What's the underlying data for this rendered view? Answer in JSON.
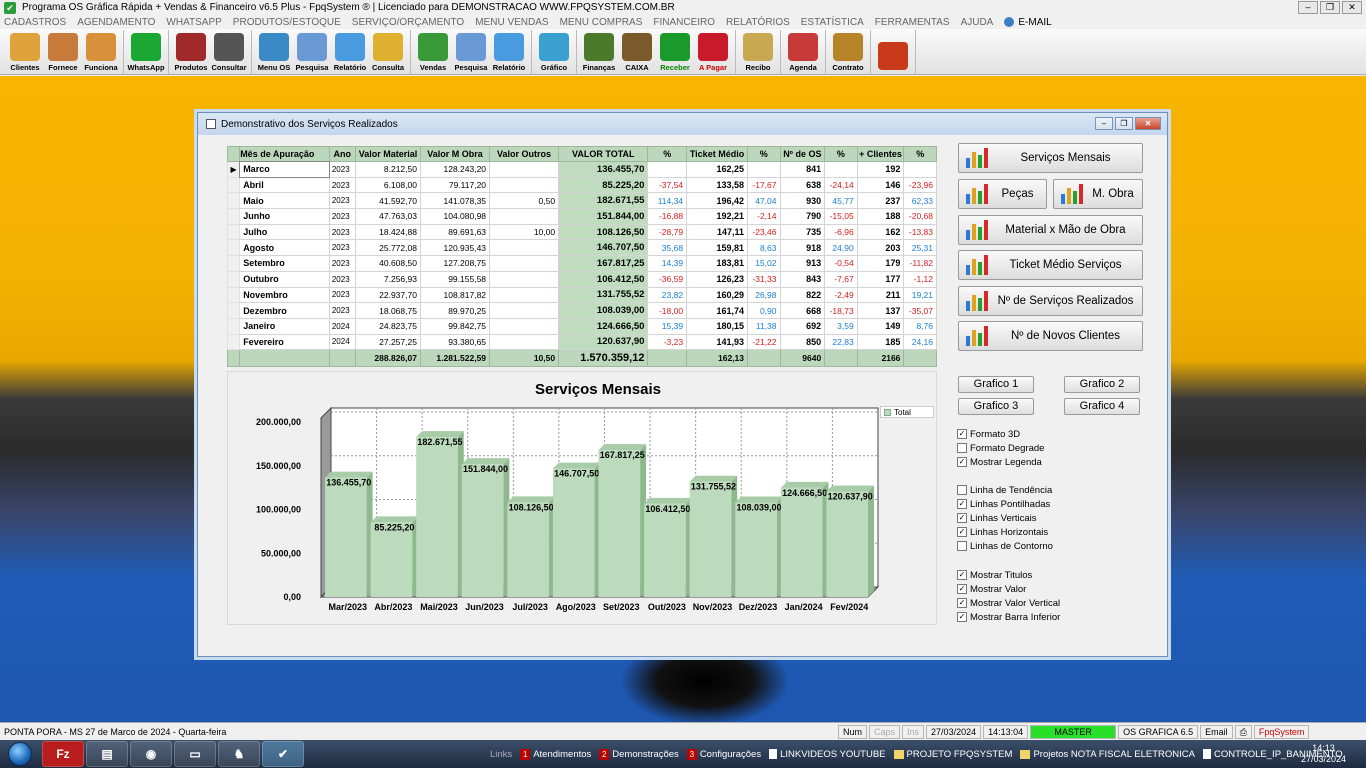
{
  "app": {
    "title": "Programa OS Gráfica Rápida + Vendas & Financeiro v6.5 Plus - FpqSystem ® | Licenciado para  DEMONSTRACAO WWW.FPQSYSTEM.COM.BR"
  },
  "menu": [
    "CADASTROS",
    "AGENDAMENTO",
    "WHATSAPP",
    "PRODUTOS/ESTOQUE",
    "SERVIÇO/ORÇAMENTO",
    "MENU VENDAS",
    "MENU COMPRAS",
    "FINANCEIRO",
    "RELATÓRIOS",
    "ESTATÍSTICA",
    "FERRAMENTAS",
    "AJUDA"
  ],
  "menu_email": "E-MAIL",
  "toolbar": [
    [
      {
        "label": "Clientes",
        "icon": "clients-icon",
        "color": "#e0a23a"
      },
      {
        "label": "Fornece",
        "icon": "supplier-icon",
        "color": "#c77a3a"
      },
      {
        "label": "Funciona",
        "icon": "employee-icon",
        "color": "#d8913a"
      }
    ],
    [
      {
        "label": "WhatsApp",
        "icon": "whatsapp-icon",
        "color": "#1aa832"
      }
    ],
    [
      {
        "label": "Produtos",
        "icon": "products-icon",
        "color": "#a02a2a"
      },
      {
        "label": "Consultar",
        "icon": "barcode-icon",
        "color": "#555555"
      }
    ],
    [
      {
        "label": "Menu OS",
        "icon": "service-order-icon",
        "color": "#3a8ac6"
      },
      {
        "label": "Pesquisa",
        "icon": "search-doc-icon",
        "color": "#6a9ad6"
      },
      {
        "label": "Relatório",
        "icon": "report-icon",
        "color": "#4a9ae0"
      },
      {
        "label": "Consulta",
        "icon": "folder-icon",
        "color": "#e0b030"
      }
    ],
    [
      {
        "label": "Vendas",
        "icon": "cart-icon",
        "color": "#3a9a3a"
      },
      {
        "label": "Pesquisa",
        "icon": "search-doc-icon",
        "color": "#6a9ad6"
      },
      {
        "label": "Relatório",
        "icon": "report-icon",
        "color": "#4a9ae0"
      }
    ],
    [
      {
        "label": "Gráfico",
        "icon": "chart-icon",
        "color": "#3aa0d0"
      }
    ],
    [
      {
        "label": "Finanças",
        "icon": "finance-icon",
        "color": "#4a7a2a"
      },
      {
        "label": "CAIXA",
        "icon": "cashier-icon",
        "color": "#7a5a2a"
      },
      {
        "label": "Receber",
        "icon": "receive-icon",
        "color": "#1a9a2a",
        "label_color": "green"
      },
      {
        "label": "A Pagar",
        "icon": "pay-icon",
        "color": "#c81a2a",
        "label_color": "red"
      }
    ],
    [
      {
        "label": "Recibo",
        "icon": "receipt-icon",
        "color": "#c8a850"
      }
    ],
    [
      {
        "label": "Agenda",
        "icon": "calendar-icon",
        "color": "#c83a3a"
      }
    ],
    [
      {
        "label": "Contrato",
        "icon": "contract-icon",
        "color": "#b8842a"
      }
    ],
    [
      {
        "label": "",
        "icon": "exit-icon",
        "color": "#c83a1a"
      }
    ]
  ],
  "dialog": {
    "title": "Demonstrativo dos Serviços Realizados"
  },
  "grid": {
    "headers": [
      "Mês de Apuração",
      "Ano",
      "Valor Material",
      "Valor M Obra",
      "Valor Outros",
      "VALOR TOTAL",
      "%",
      "Ticket Médio",
      "%",
      "Nº de OS",
      "%",
      "+ Clientes",
      "%"
    ],
    "rows": [
      {
        "mes": "Marco",
        "ano": "2023",
        "material": "8.212,50",
        "mobra": "128.243,20",
        "outros": "",
        "total": "136.455,70",
        "p1": "",
        "ticket": "162,25",
        "p2": "",
        "nos": "841",
        "p3": "",
        "clientes": "192",
        "p4": ""
      },
      {
        "mes": "Abril",
        "ano": "2023",
        "material": "6.108,00",
        "mobra": "79.117,20",
        "outros": "",
        "total": "85.225,20",
        "p1": "-37,54",
        "ticket": "133,58",
        "p2": "-17,67",
        "nos": "638",
        "p3": "-24,14",
        "clientes": "146",
        "p4": "-23,96"
      },
      {
        "mes": "Maio",
        "ano": "2023",
        "material": "41.592,70",
        "mobra": "141.078,35",
        "outros": "0,50",
        "total": "182.671,55",
        "p1": "114,34",
        "ticket": "196,42",
        "p2": "47,04",
        "nos": "930",
        "p3": "45,77",
        "clientes": "237",
        "p4": "62,33"
      },
      {
        "mes": "Junho",
        "ano": "2023",
        "material": "47.763,03",
        "mobra": "104.080,98",
        "outros": "",
        "total": "151.844,00",
        "p1": "-16,88",
        "ticket": "192,21",
        "p2": "-2,14",
        "nos": "790",
        "p3": "-15,05",
        "clientes": "188",
        "p4": "-20,68"
      },
      {
        "mes": "Julho",
        "ano": "2023",
        "material": "18.424,88",
        "mobra": "89.691,63",
        "outros": "10,00",
        "total": "108.126,50",
        "p1": "-28,79",
        "ticket": "147,11",
        "p2": "-23,46",
        "nos": "735",
        "p3": "-6,96",
        "clientes": "162",
        "p4": "-13,83"
      },
      {
        "mes": "Agosto",
        "ano": "2023",
        "material": "25.772,08",
        "mobra": "120.935,43",
        "outros": "",
        "total": "146.707,50",
        "p1": "35,68",
        "ticket": "159,81",
        "p2": "8,63",
        "nos": "918",
        "p3": "24,90",
        "clientes": "203",
        "p4": "25,31"
      },
      {
        "mes": "Setembro",
        "ano": "2023",
        "material": "40.608,50",
        "mobra": "127.208,75",
        "outros": "",
        "total": "167.817,25",
        "p1": "14,39",
        "ticket": "183,81",
        "p2": "15,02",
        "nos": "913",
        "p3": "-0,54",
        "clientes": "179",
        "p4": "-11,82"
      },
      {
        "mes": "Outubro",
        "ano": "2023",
        "material": "7.256,93",
        "mobra": "99.155,58",
        "outros": "",
        "total": "106.412,50",
        "p1": "-36,59",
        "ticket": "126,23",
        "p2": "-31,33",
        "nos": "843",
        "p3": "-7,67",
        "clientes": "177",
        "p4": "-1,12"
      },
      {
        "mes": "Novembro",
        "ano": "2023",
        "material": "22.937,70",
        "mobra": "108.817,82",
        "outros": "",
        "total": "131.755,52",
        "p1": "23,82",
        "ticket": "160,29",
        "p2": "26,98",
        "nos": "822",
        "p3": "-2,49",
        "clientes": "211",
        "p4": "19,21"
      },
      {
        "mes": "Dezembro",
        "ano": "2023",
        "material": "18.068,75",
        "mobra": "89.970,25",
        "outros": "",
        "total": "108.039,00",
        "p1": "-18,00",
        "ticket": "161,74",
        "p2": "0,90",
        "nos": "668",
        "p3": "-18,73",
        "clientes": "137",
        "p4": "-35,07"
      },
      {
        "mes": "Janeiro",
        "ano": "2024",
        "material": "24.823,75",
        "mobra": "99.842,75",
        "outros": "",
        "total": "124.666,50",
        "p1": "15,39",
        "ticket": "180,15",
        "p2": "11,38",
        "nos": "692",
        "p3": "3,59",
        "clientes": "149",
        "p4": "8,76"
      },
      {
        "mes": "Fevereiro",
        "ano": "2024",
        "material": "27.257,25",
        "mobra": "93.380,65",
        "outros": "",
        "total": "120.637,90",
        "p1": "-3,23",
        "ticket": "141,93",
        "p2": "-21,22",
        "nos": "850",
        "p3": "22,83",
        "clientes": "185",
        "p4": "24,16"
      }
    ],
    "totals": {
      "material": "288.826,07",
      "mobra": "1.281.522,59",
      "outros": "10,50",
      "total": "1.570.359,12",
      "ticket": "162,13",
      "nos": "9640",
      "clientes": "2166"
    },
    "row_indicator": "▶"
  },
  "chart_data": {
    "type": "bar",
    "title": "Serviços Mensais",
    "categories": [
      "Mar/2023",
      "Abr/2023",
      "Mai/2023",
      "Jun/2023",
      "Jul/2023",
      "Ago/2023",
      "Set/2023",
      "Out/2023",
      "Nov/2023",
      "Dez/2023",
      "Jan/2024",
      "Fev/2024"
    ],
    "series": [
      {
        "name": "Total",
        "values": [
          136455.7,
          85225.2,
          182671.55,
          151844.0,
          108126.5,
          146707.5,
          167817.25,
          106412.5,
          131755.52,
          108039.0,
          124666.5,
          120637.9
        ]
      }
    ],
    "value_labels": [
      "136.455,70",
      "85.225,20",
      "182.671,55",
      "151.844,00",
      "108.126,50",
      "146.707,50",
      "167.817,25",
      "106.412,50",
      "131.755,52",
      "108.039,00",
      "124.666,50",
      "120.637,90"
    ],
    "yticks": [
      0,
      50000,
      100000,
      150000,
      200000
    ],
    "ytick_labels": [
      "0,00",
      "50.000,00",
      "100.000,00",
      "150.000,00",
      "200.000,00"
    ],
    "ylim": [
      0,
      200000
    ],
    "legend": "top-right",
    "grid": true,
    "bar_color": "#bcdabc",
    "style": "3d"
  },
  "side_buttons": {
    "servicos_mensais": "Serviços Mensais",
    "pecas": "Peças",
    "mobra": "M. Obra",
    "material_mao": "Material x Mão de Obra",
    "ticket_medio": "Ticket Médio Serviços",
    "num_servicos": "Nº de Serviços Realizados",
    "num_clientes": "Nº de Novos Clientes",
    "grafico1": "Grafico 1",
    "grafico2": "Grafico 2",
    "grafico3": "Grafico 3",
    "grafico4": "Grafico 4"
  },
  "options": [
    {
      "label": "Formato 3D",
      "checked": true
    },
    {
      "label": "Formato Degrade",
      "checked": false
    },
    {
      "label": "Mostrar Legenda",
      "checked": true
    },
    {
      "label": "Linha de Tendência",
      "checked": false
    },
    {
      "label": "Linhas Pontilhadas",
      "checked": true
    },
    {
      "label": "Linhas Verticais",
      "checked": true
    },
    {
      "label": "Linhas Horizontais",
      "checked": true
    },
    {
      "label": "Linhas de Contorno",
      "checked": false
    },
    {
      "label": "Mostrar Titulos",
      "checked": true
    },
    {
      "label": "Mostrar Valor",
      "checked": true
    },
    {
      "label": "Mostrar Valor Vertical",
      "checked": true
    },
    {
      "label": "Mostrar Barra Inferior",
      "checked": true
    }
  ],
  "statusbar": {
    "location": "PONTA PORA - MS 27 de Marco de 2024 - Quarta-feira",
    "num": "Num",
    "caps": "Caps",
    "ins": "Ins",
    "date": "27/03/2024",
    "time": "14:13:04",
    "master": "MASTER",
    "module": "OS GRAFICA 6.5",
    "email": "Email",
    "brand": "FpqSystem"
  },
  "taskbar": {
    "apps": [
      "filezilla",
      "explorer",
      "chrome",
      "files",
      "game",
      "fpq"
    ],
    "links_label": "Links",
    "links": [
      {
        "num": "1",
        "label": "Atendimentos"
      },
      {
        "num": "2",
        "label": "Demonstrações"
      },
      {
        "num": "3",
        "label": "Configurações"
      },
      {
        "type": "page",
        "label": "LINKVIDEOS YOUTUBE"
      },
      {
        "type": "folder",
        "label": "PROJETO FPQSYSTEM"
      },
      {
        "type": "folder",
        "label": "Projetos NOTA FISCAL ELETRONICA"
      },
      {
        "type": "page",
        "label": "CONTROLE_IP_BANIMENTO"
      }
    ],
    "clock_time": "14:13",
    "clock_date": "27/03/2024"
  }
}
